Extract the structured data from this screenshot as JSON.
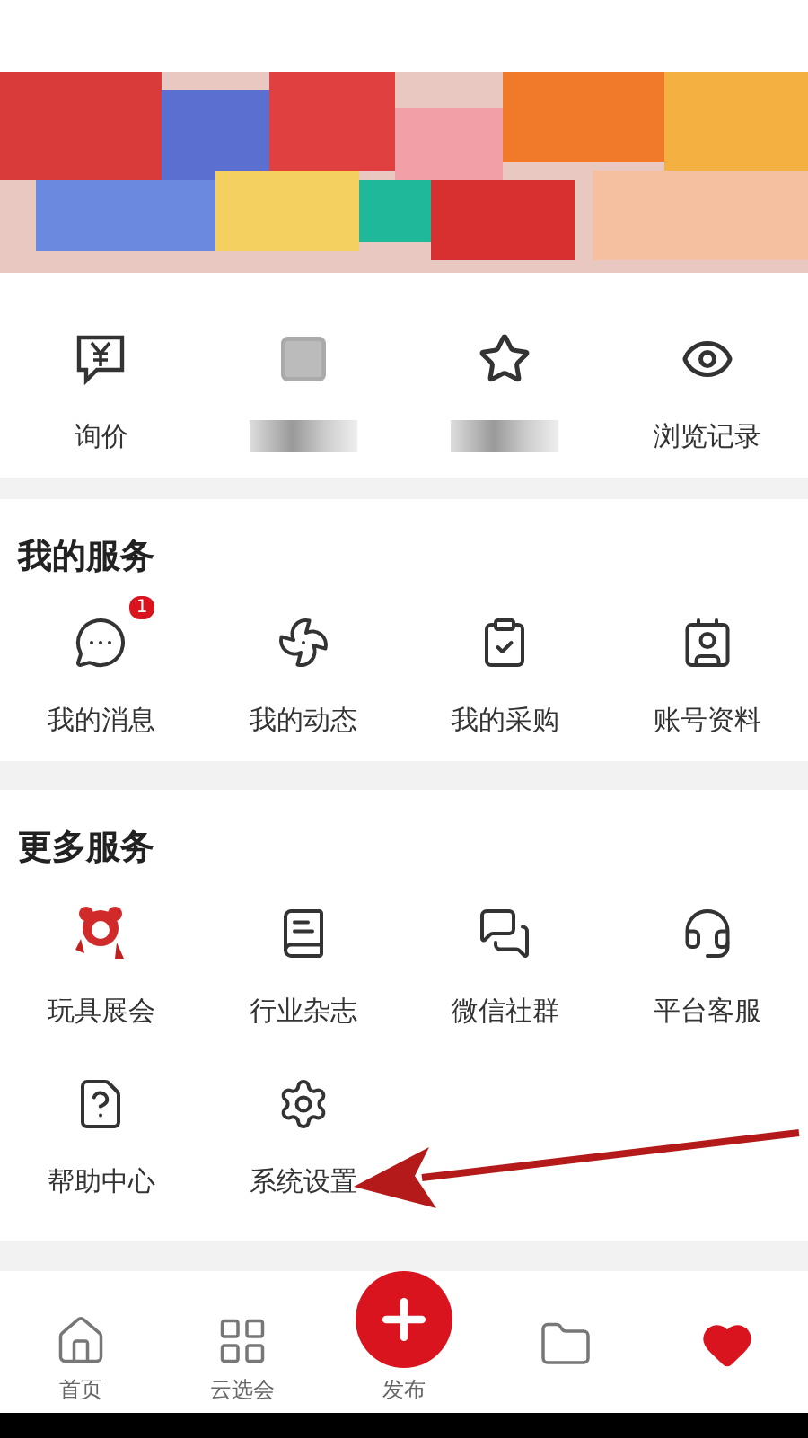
{
  "quick_links": [
    {
      "kind": "text",
      "label": "询价"
    },
    {
      "kind": "obscured"
    },
    {
      "kind": "obscured"
    },
    {
      "kind": "text",
      "label": "浏览记录"
    }
  ],
  "my_services": {
    "title": "我的服务",
    "items": [
      {
        "label": "我的消息",
        "badge": "1"
      },
      {
        "label": "我的动态"
      },
      {
        "label": "我的采购"
      },
      {
        "label": "账号资料"
      }
    ]
  },
  "more_services": {
    "title": "更多服务",
    "items": [
      {
        "label": "玩具展会"
      },
      {
        "label": "行业杂志"
      },
      {
        "label": "微信社群"
      },
      {
        "label": "平台客服"
      },
      {
        "label": "帮助中心"
      },
      {
        "label": "系统设置"
      }
    ]
  },
  "tab_bar": [
    {
      "label": "首页",
      "selected": false
    },
    {
      "label": "云选会",
      "selected": false
    },
    {
      "label": "发布",
      "selected": false,
      "kind": "publish"
    },
    {
      "selected": false
    },
    {
      "selected": true
    }
  ]
}
